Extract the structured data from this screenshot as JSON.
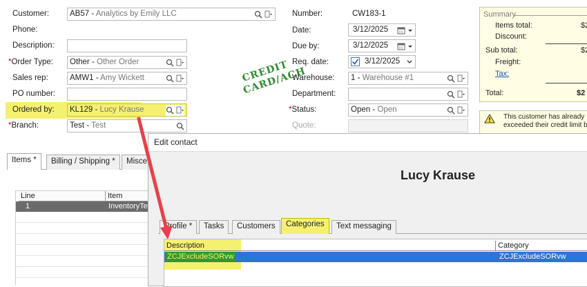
{
  "left_fields": {
    "customer": {
      "label": "Customer:",
      "code": "AB57",
      "desc": "Analytics by Emily LLC"
    },
    "phone": {
      "label": "Phone:"
    },
    "description": {
      "label": "Description:",
      "value": ""
    },
    "order_type": {
      "label_req": "*",
      "label": "Order Type:",
      "code": "Other",
      "desc": "Other Order"
    },
    "sales_rep": {
      "label": "Sales rep:",
      "code": "AMW1",
      "desc": "Amy Wickett"
    },
    "po_number": {
      "label": "PO number:",
      "value": ""
    },
    "ordered_by": {
      "label": "Ordered by:",
      "code": "KL129",
      "desc": "Lucy Krause"
    },
    "branch": {
      "label_req": "*",
      "label": "Branch:",
      "code": "Test",
      "desc": "Test"
    }
  },
  "mid_fields": {
    "number": {
      "label": "Number:",
      "value": "CW183-1"
    },
    "date": {
      "label": "Date:",
      "value": "3/12/2025"
    },
    "due_by": {
      "label": "Due by:",
      "value": "3/12/2025"
    },
    "req_date": {
      "label": "Req. date:",
      "value": "3/12/2025"
    },
    "warehouse": {
      "label": "Warehouse:",
      "code": "1",
      "desc": "Warehouse #1"
    },
    "department": {
      "label": "Department:",
      "value": ""
    },
    "status": {
      "label_req": "*",
      "label": "Status:",
      "code": "Open",
      "desc": "Open"
    },
    "quote": {
      "label": "Quote:",
      "value": ""
    }
  },
  "stamp": {
    "line1": "CREDIT",
    "line2": "CARD/ACH"
  },
  "summary": {
    "header": "Summary",
    "items_total_label": "Items total:",
    "items_total_value": "$2",
    "discount_label": "Discount:",
    "sub_total_label": "Sub total:",
    "sub_total_value": "$2",
    "freight_label": "Freight:",
    "tax_label": "Tax:",
    "total_label": "Total:",
    "total_value": "$2"
  },
  "warning": {
    "text": "This customer has already exceeded their credit limit by"
  },
  "main_tabs": [
    "Items *",
    "Billing / Shipping *",
    "Misce"
  ],
  "items_grid": {
    "headers": [
      "Line",
      "Item"
    ],
    "rows": [
      {
        "line": "1",
        "item": "InventoryTe"
      }
    ]
  },
  "dialog": {
    "title": "Edit contact",
    "contact_name": "Lucy Krause",
    "tabs": [
      "Profile *",
      "Tasks",
      "Customers",
      "Categories",
      "Text messaging"
    ],
    "active_tab": "Categories",
    "grid_headers": [
      "Description",
      "Category"
    ],
    "rows": [
      {
        "description": "ZCJExcludeSORvw",
        "category": "ZCJExcludeSORvw"
      }
    ]
  },
  "colors": {
    "highlight": "#f5f170",
    "selection": "#2c74d6",
    "arrow": "#e8404a",
    "stamp": "#2e8b2e",
    "required": "#cc0000"
  }
}
